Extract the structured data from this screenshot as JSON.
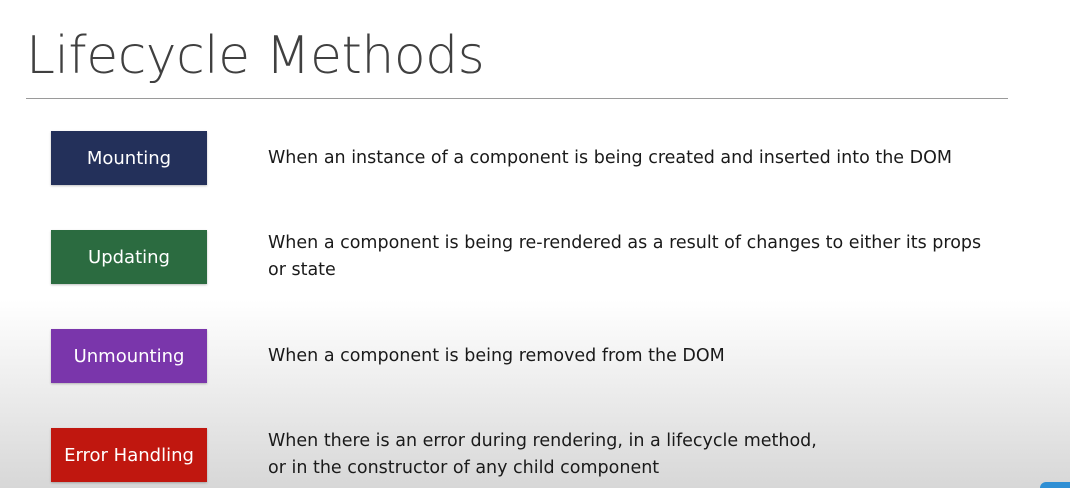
{
  "slide": {
    "title": "Lifecycle Methods",
    "phases": [
      {
        "label": "Mounting",
        "color": "#23305a",
        "description": "When an instance of a component is being created and inserted into the DOM"
      },
      {
        "label": "Updating",
        "color": "#2b6b40",
        "description": "When a component is being re-rendered as a result of changes to either its props\nor state"
      },
      {
        "label": "Unmounting",
        "color": "#7a36ab",
        "description": "When a component is being removed from the DOM"
      },
      {
        "label": "Error Handling",
        "color": "#c0170f",
        "description": "When there is an error during rendering, in a lifecycle method,\nor in the constructor of any child component"
      }
    ]
  }
}
